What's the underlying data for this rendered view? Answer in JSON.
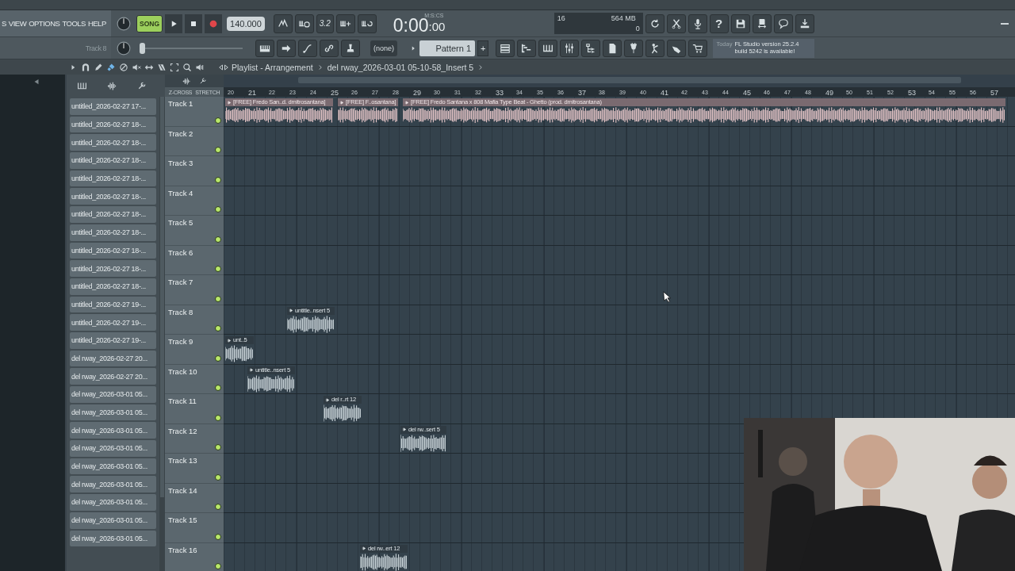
{
  "menu": [
    "S",
    "VIEW",
    "OPTIONS",
    "TOOLS",
    "HELP"
  ],
  "song_mode": {
    "label": "SONG",
    "selected": true
  },
  "tempo": "140.000",
  "countdown": "3.2",
  "time": {
    "format": "M:S:CS",
    "main": "0:00",
    "centis": ":00"
  },
  "monitor": {
    "voices": "16",
    "memory": "564 MB",
    "cpu": "0"
  },
  "help": "?",
  "hint": "Track 8",
  "master_slider": {
    "level": 0.02
  },
  "pattern": {
    "selector": "(none)",
    "name": "Pattern 1",
    "add": "+"
  },
  "news": {
    "when": "Today",
    "message": "FL Studio version 25.2.4 build 5242 is available!"
  },
  "playlist": {
    "title": "Playlist - Arrangement",
    "clip_source": "del rway_2026-03-01 05-10-58_Insert 5",
    "zcross": "Z-CROSS",
    "stretch": "STRETCH"
  },
  "browser_items": [
    "untitled_2026-02-27 17-...",
    "untitled_2026-02-27 18-...",
    "untitled_2026-02-27 18-...",
    "untitled_2026-02-27 18-...",
    "untitled_2026-02-27 18-...",
    "untitled_2026-02-27 18-...",
    "untitled_2026-02-27 18-...",
    "untitled_2026-02-27 18-...",
    "untitled_2026-02-27 18-...",
    "untitled_2026-02-27 18-...",
    "untitled_2026-02-27 18-...",
    "untitled_2026-02-27 19-...",
    "untitled_2026-02-27 19-...",
    "untitled_2026-02-27 19-...",
    "del rway_2026-02-27 20...",
    "del rway_2026-02-27 20...",
    "del rway_2026-03-01 05...",
    "del rway_2026-03-01 05...",
    "del rway_2026-03-01 05...",
    "del rway_2026-03-01 05...",
    "del rway_2026-03-01 05...",
    "del rway_2026-03-01 05...",
    "del rway_2026-03-01 05...",
    "del rway_2026-03-01 05...",
    "del rway_2026-03-01 05..."
  ],
  "ruler": [
    {
      "label": "20",
      "major": false
    },
    {
      "label": "21",
      "major": true
    },
    {
      "label": "22",
      "major": false
    },
    {
      "label": "23",
      "major": false
    },
    {
      "label": "24",
      "major": false
    },
    {
      "label": "25",
      "major": true
    },
    {
      "label": "26",
      "major": false
    },
    {
      "label": "27",
      "major": false
    },
    {
      "label": "28",
      "major": false
    },
    {
      "label": "29",
      "major": true
    },
    {
      "label": "30",
      "major": false
    },
    {
      "label": "31",
      "major": false
    },
    {
      "label": "32",
      "major": false
    },
    {
      "label": "33",
      "major": true
    },
    {
      "label": "34",
      "major": false
    },
    {
      "label": "35",
      "major": false
    },
    {
      "label": "36",
      "major": false
    },
    {
      "label": "37",
      "major": true
    },
    {
      "label": "38",
      "major": false
    },
    {
      "label": "39",
      "major": false
    },
    {
      "label": "40",
      "major": false
    },
    {
      "label": "41",
      "major": true
    },
    {
      "label": "42",
      "major": false
    },
    {
      "label": "43",
      "major": false
    },
    {
      "label": "44",
      "major": false
    },
    {
      "label": "45",
      "major": true
    },
    {
      "label": "46",
      "major": false
    },
    {
      "label": "47",
      "major": false
    },
    {
      "label": "48",
      "major": false
    },
    {
      "label": "49",
      "major": true
    },
    {
      "label": "50",
      "major": false
    },
    {
      "label": "51",
      "major": false
    },
    {
      "label": "52",
      "major": false
    },
    {
      "label": "53",
      "major": true
    },
    {
      "label": "54",
      "major": false
    },
    {
      "label": "55",
      "major": false
    },
    {
      "label": "56",
      "major": false
    },
    {
      "label": "57",
      "major": true
    }
  ],
  "tracks": [
    {
      "name": "Track 1",
      "clips": [
        {
          "label": "[FREE] Fredo San..d. dmitrosantana]",
          "kind": "beat"
        },
        {
          "label": "[FREE] F..osantana]",
          "kind": "beat"
        },
        {
          "label": "[FREE] Fredo Santana x 808 Mafia Type Beat - Ghetto (prod. dmitrosantana)",
          "kind": "beat"
        }
      ]
    },
    {
      "name": "Track 2"
    },
    {
      "name": "Track 3"
    },
    {
      "name": "Track 4"
    },
    {
      "name": "Track 5"
    },
    {
      "name": "Track 6"
    },
    {
      "name": "Track 7"
    },
    {
      "name": "Track 8",
      "clips": [
        {
          "label": "untitle..nsert 5",
          "kind": "vocal"
        }
      ]
    },
    {
      "name": "Track 9",
      "clips": [
        {
          "label": "unt..5",
          "kind": "vocal"
        }
      ]
    },
    {
      "name": "Track 10",
      "clips": [
        {
          "label": "untitle..nsert 5",
          "kind": "vocal"
        }
      ]
    },
    {
      "name": "Track 11",
      "clips": [
        {
          "label": "del r..rt 12",
          "kind": "vocal"
        }
      ]
    },
    {
      "name": "Track 12",
      "clips": [
        {
          "label": "del rw..sert 5",
          "kind": "vocal"
        }
      ]
    },
    {
      "name": "Track 13"
    },
    {
      "name": "Track 14"
    },
    {
      "name": "Track 15"
    },
    {
      "name": "Track 16",
      "clips": [
        {
          "label": "del rw..ert 12",
          "kind": "vocal"
        }
      ]
    }
  ]
}
